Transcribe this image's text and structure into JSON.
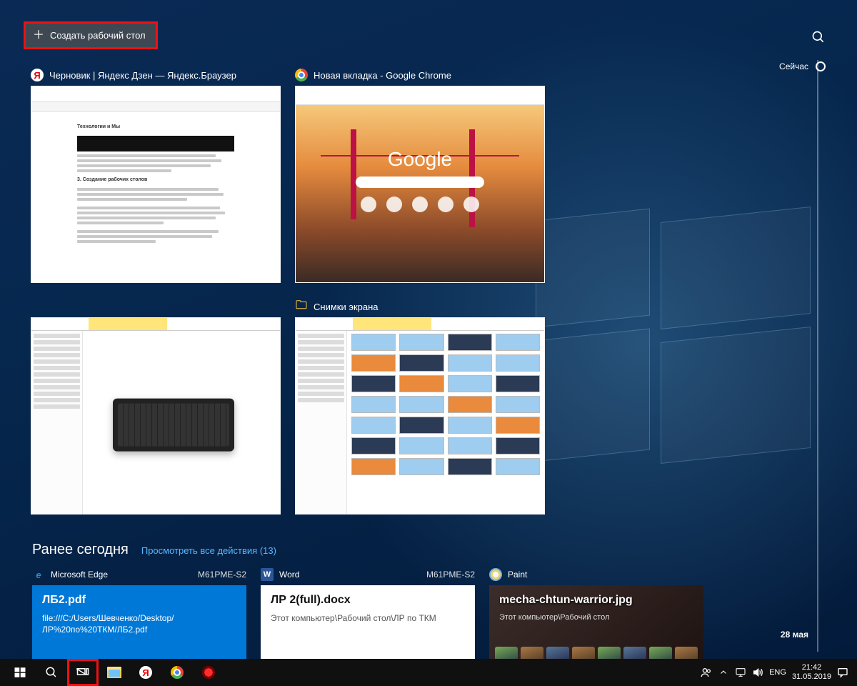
{
  "new_desktop_label": "Создать рабочий стол",
  "timeline": {
    "now_label": "Сейчас",
    "past_label": "28 мая"
  },
  "windows": [
    {
      "title": "Черновик | Яндекс Дзен — Яндекс.Браузер",
      "icon": "yb",
      "doc": {
        "heading1": "Технологии и Мы",
        "heading2": "3. Создание рабочих столов"
      }
    },
    {
      "title": "Новая вкладка - Google Chrome",
      "icon": "chrome",
      "google": "Google"
    },
    {
      "title": "",
      "icon": "",
      "explorer1": true
    },
    {
      "title": "Снимки экрана",
      "icon": "folder",
      "explorer2": true
    }
  ],
  "earlier": {
    "heading": "Ранее сегодня",
    "view_all": "Просмотреть все действия (13)",
    "cards": [
      {
        "app": "Microsoft Edge",
        "source": "M61PME-S2",
        "title": "ЛБ2.pdf",
        "sub": "file:///C:/Users/Шевченко/Desktop/ЛР%20по%20ТКМ/ЛБ2.pdf"
      },
      {
        "app": "Word",
        "source": "M61PME-S2",
        "title": "ЛР 2(full).docx",
        "sub": "Этот компьютер\\Рабочий стол\\ЛР по ТКМ"
      },
      {
        "app": "Paint",
        "source": "",
        "title": "mecha-chtun-warrior.jpg",
        "sub": "Этот компьютер\\Рабочий стол"
      }
    ]
  },
  "taskbar": {
    "lang": "ENG",
    "time": "21:42",
    "date": "31.05.2019"
  }
}
